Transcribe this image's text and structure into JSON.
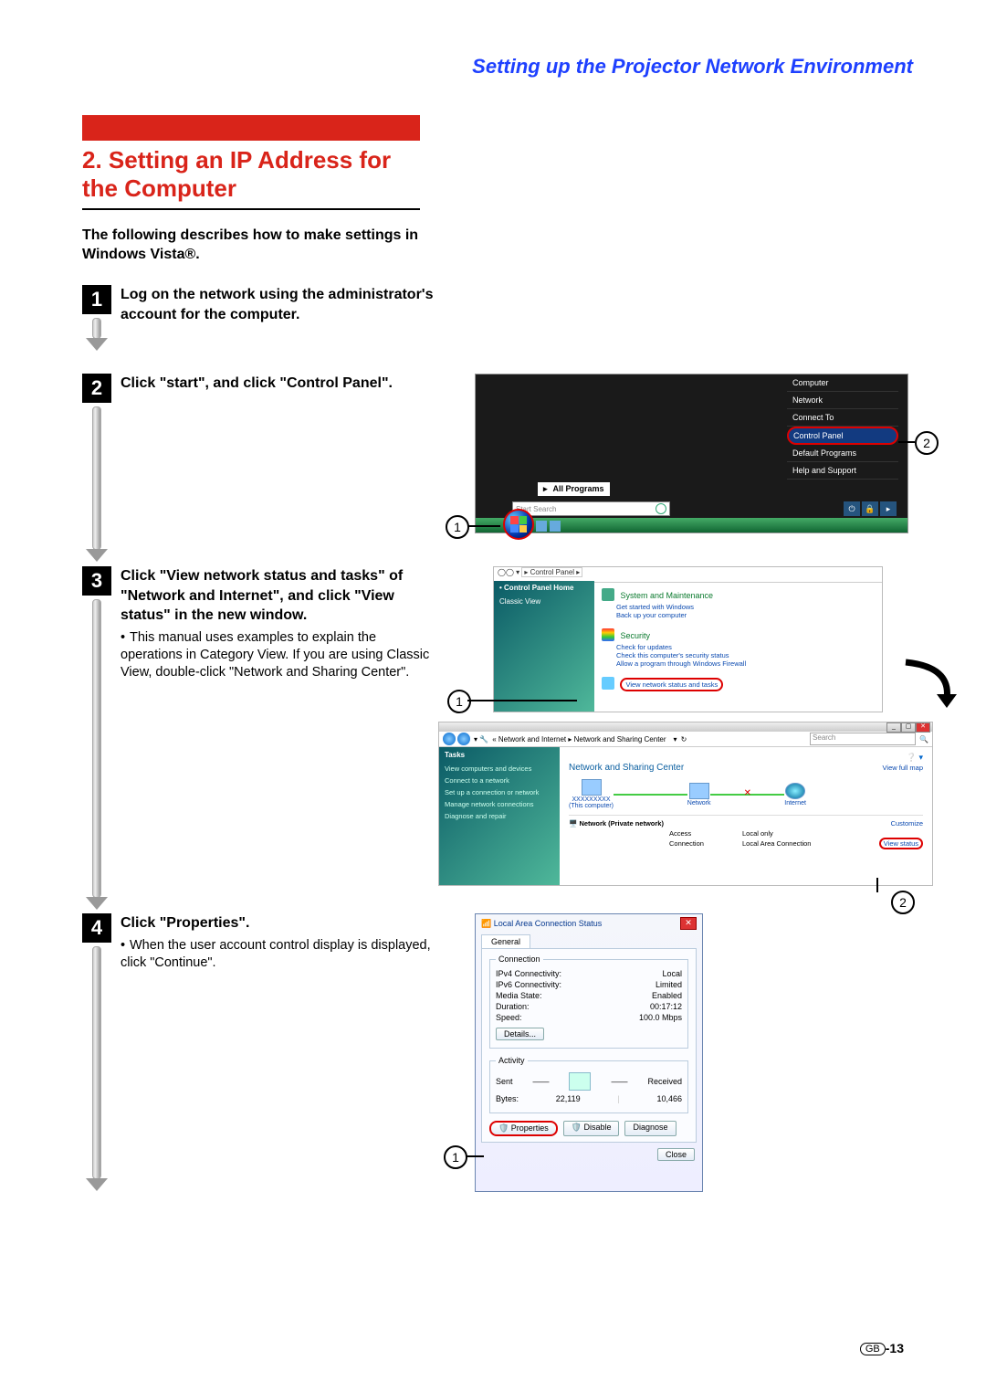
{
  "header": "Setting up the Projector Network Environment",
  "chapter": {
    "num": "2.",
    "title": "Setting an IP Address for the Computer"
  },
  "intro": "The following describes how to make settings in Windows Vista®.",
  "steps": [
    {
      "n": "1",
      "title": "Log on the network using the administrator's account for the computer."
    },
    {
      "n": "2",
      "title": "Click \"start\", and click \"Control Panel\"."
    },
    {
      "n": "3",
      "title": "Click \"View network status and tasks\" of \"Network and Internet\", and click \"View status\" in the new window.",
      "note": "This manual uses examples to explain the operations in Category View. If you are using Classic View, double-click \"Network and Sharing Center\"."
    },
    {
      "n": "4",
      "title": "Click \"Properties\".",
      "note": "When the user account control display is displayed, click \"Continue\"."
    }
  ],
  "startMenu": {
    "items": [
      "Computer",
      "Network",
      "Connect To",
      "Control Panel",
      "Default Programs",
      "Help and Support"
    ],
    "highlighted": "Control Panel",
    "allPrograms": "All Programs",
    "searchPlaceholder": "Start Search",
    "powerIcons": [
      "⏻",
      "🔒",
      "▸"
    ]
  },
  "controlPanel": {
    "address": "▸ Control Panel ▸",
    "sideLinks": [
      "Control Panel Home",
      "Classic View"
    ],
    "cats": [
      {
        "title": "System and Maintenance",
        "subs": [
          "Get started with Windows",
          "Back up your computer"
        ]
      },
      {
        "title": "Security",
        "subs": [
          "Check for updates",
          "Check this computer's security status",
          "Allow a program through Windows Firewall"
        ]
      }
    ],
    "highlightLink": "View network status and tasks"
  },
  "nsc": {
    "breadcrumb": "« Network and Internet ▸ Network and Sharing Center",
    "searchHint": "Search",
    "tasksHd": "Tasks",
    "tasks": [
      "View computers and devices",
      "Connect to a network",
      "Set up a connection or network",
      "Manage network connections",
      "Diagnose and repair"
    ],
    "title": "Network and Sharing Center",
    "viewFullMap": "View full map",
    "nodes": {
      "pc": "XXXXXXXXX",
      "pcSub": "(This computer)",
      "net": "Network",
      "inet": "Internet"
    },
    "netHeader": "Network (Private network)",
    "rows": [
      {
        "k": "Access",
        "v": "Local only"
      },
      {
        "k": "Connection",
        "v": "Local Area Connection"
      }
    ],
    "customize": "Customize",
    "viewStatus": "View status"
  },
  "lac": {
    "title": "Local Area Connection Status",
    "tab": "General",
    "connLegend": "Connection",
    "kv": [
      {
        "k": "IPv4 Connectivity:",
        "v": "Local"
      },
      {
        "k": "IPv6 Connectivity:",
        "v": "Limited"
      },
      {
        "k": "Media State:",
        "v": "Enabled"
      },
      {
        "k": "Duration:",
        "v": "00:17:12"
      },
      {
        "k": "Speed:",
        "v": "100.0 Mbps"
      }
    ],
    "details": "Details...",
    "activityLegend": "Activity",
    "sent": "Sent",
    "received": "Received",
    "bytesLabel": "Bytes:",
    "bytesSent": "22,119",
    "bytesRecv": "10,466",
    "btnProperties": "Properties",
    "btnDisable": "Disable",
    "btnDiagnose": "Diagnose",
    "btnClose": "Close"
  },
  "callouts": {
    "c1": "1",
    "c2": "2"
  },
  "pageNum": {
    "region": "GB",
    "sep": "-",
    "num": "13"
  }
}
